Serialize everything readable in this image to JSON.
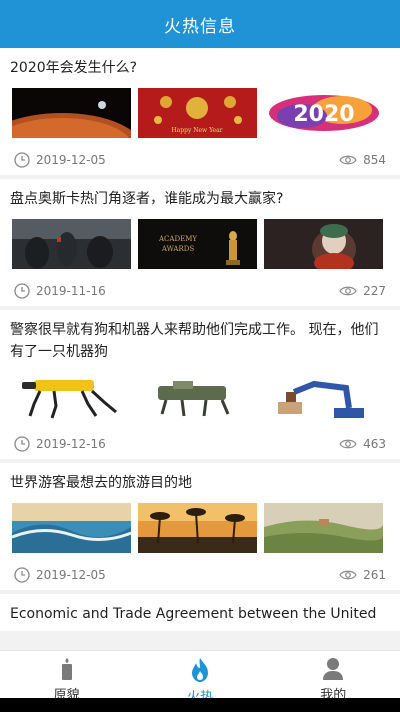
{
  "header": {
    "title": "火热信息"
  },
  "articles": [
    {
      "title": "2020年会发生什么?",
      "date": "2019-12-05",
      "views": "854"
    },
    {
      "title": "盘点奥斯卡热门角逐者，谁能成为最大赢家?",
      "date": "2019-11-16",
      "views": "227"
    },
    {
      "title": "警察很早就有狗和机器人来帮助他们完成工作。 现在，他们有了一只机器狗",
      "date": "2019-12-16",
      "views": "463"
    },
    {
      "title": "世界游客最想去的旅游目的地",
      "date": "2019-12-05",
      "views": "261"
    },
    {
      "title": "Economic and Trade Agreement between the United"
    }
  ],
  "thumb_text": {
    "newyear": "Happy New Year",
    "year2020": "2020",
    "academy": "ACADEMY\nAWARDS"
  },
  "tabs": [
    {
      "label": "原貌",
      "icon": "candle-icon"
    },
    {
      "label": "火热",
      "icon": "flame-icon",
      "active": true
    },
    {
      "label": "我的",
      "icon": "person-icon"
    }
  ],
  "colors": {
    "accent": "#1f93d6",
    "header_bg": "#1f93d6"
  }
}
